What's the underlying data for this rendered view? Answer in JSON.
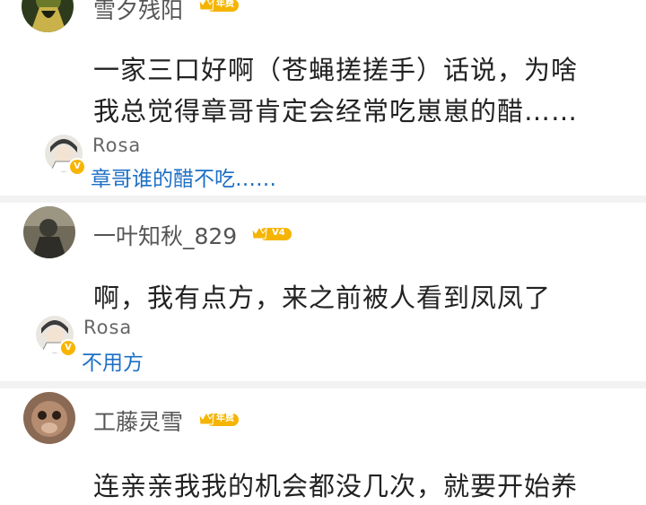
{
  "comments": [
    {
      "user": "雪夕残阳",
      "badge": "年费",
      "lines": [
        "一家三口好啊（苍蝇搓搓手）话说，为啥",
        "我总觉得章哥肯定会经常吃崽崽的醋……"
      ],
      "reply": {
        "user": "Rosa",
        "text": "章哥谁的醋不吃……"
      }
    },
    {
      "user": "一叶知秋_829",
      "badge": "V4",
      "lines": [
        "啊，我有点方，来之前被人看到凤凤了"
      ],
      "reply": {
        "user": "Rosa",
        "text": "不用方"
      }
    },
    {
      "user": "工藤灵雪",
      "badge": "年费",
      "lines": [
        "连亲亲我我的机会都没几次，就要开始养"
      ]
    }
  ],
  "colors": {
    "badge_gold": "#f5b400",
    "reply_link": "#1d6fc5",
    "verified": "#f7b500"
  },
  "icons": [
    "crown-icon",
    "verified-icon"
  ]
}
